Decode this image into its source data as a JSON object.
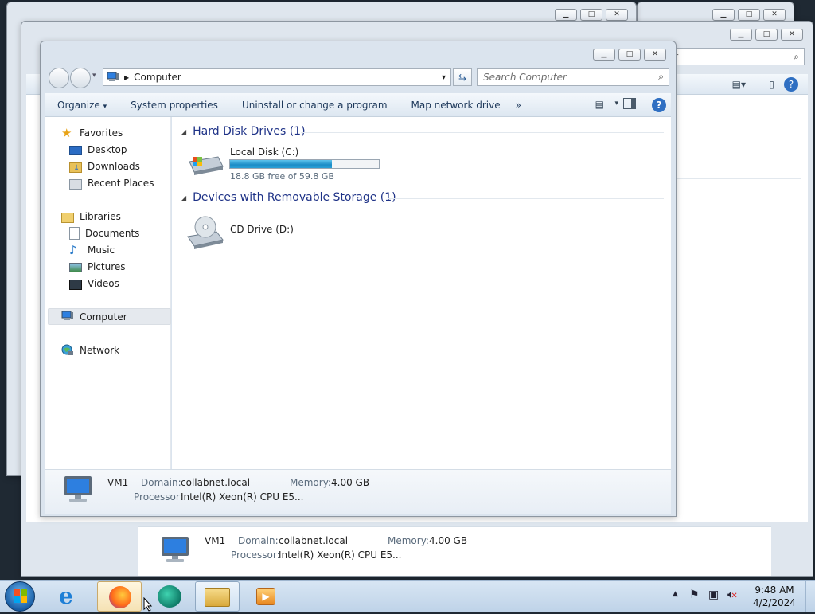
{
  "front": {
    "address": {
      "location": "Computer"
    },
    "search": {
      "placeholder": "Search Computer"
    },
    "toolbar": {
      "organize": "Organize",
      "system_properties": "System properties",
      "uninstall": "Uninstall or change a program",
      "map_drive": "Map network drive",
      "more": "»"
    },
    "nav": {
      "favorites": "Favorites",
      "desktop": "Desktop",
      "downloads": "Downloads",
      "recent": "Recent Places",
      "libraries": "Libraries",
      "documents": "Documents",
      "music": "Music",
      "pictures": "Pictures",
      "videos": "Videos",
      "computer": "Computer",
      "network": "Network"
    },
    "content": {
      "hdd_group": "Hard Disk Drives (1)",
      "local_disk_name": "Local Disk (C:)",
      "local_disk_free": "18.8 GB free of 59.8 GB",
      "local_disk_used_fraction": 0.686,
      "removable_group": "Devices with Removable Storage (1)",
      "cd_name": "CD Drive (D:)"
    },
    "details": {
      "name": "VM1",
      "domain_label": "Domain:",
      "domain_value": "collabnet.local",
      "memory_label": "Memory:",
      "memory_value": "4.00 GB",
      "processor_label": "Processor:",
      "processor_value": "Intel(R) Xeon(R) CPU E5..."
    }
  },
  "back": {
    "search_partial": "uter",
    "details": {
      "name": "VM1",
      "domain_label": "Domain:",
      "domain_value": "collabnet.local",
      "memory_label": "Memory:",
      "memory_value": "4.00 GB",
      "processor_label": "Processor:",
      "processor_value": "Intel(R) Xeon(R) CPU E5..."
    }
  },
  "taskbar": {
    "time": "9:48 AM",
    "date": "4/2/2024",
    "apps": [
      "start-icon",
      "internet-explorer-icon",
      "firefox-icon",
      "app-icon",
      "file-explorer-icon",
      "media-player-icon"
    ]
  },
  "colors": {
    "accent_blue": "#1e3287",
    "progress": "#26a0da",
    "taskbar": "#c9dbee"
  }
}
